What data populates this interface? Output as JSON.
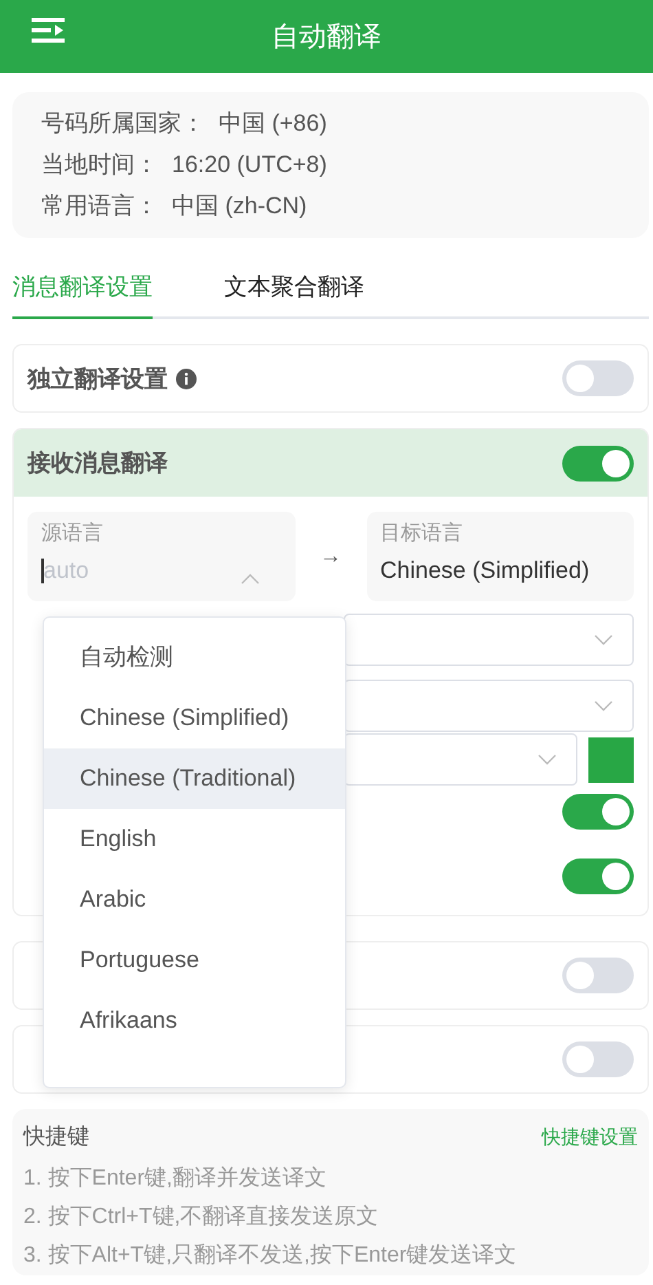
{
  "header": {
    "title": "自动翻译"
  },
  "info": [
    {
      "label": "号码所属国家：",
      "value": "中国 (+86)"
    },
    {
      "label": "当地时间：",
      "value": "16:20 (UTC+8)"
    },
    {
      "label": "常用语言：",
      "value": "中国 (zh-CN)"
    }
  ],
  "tabs": [
    {
      "label": "消息翻译设置",
      "selected": true
    },
    {
      "label": "文本聚合翻译",
      "selected": false
    }
  ],
  "independent": {
    "title": "独立翻译设置",
    "on": false
  },
  "receive": {
    "title": "接收消息翻译",
    "on": true,
    "source": {
      "label": "源语言",
      "placeholder": "auto",
      "expanded": true
    },
    "arrow": "→",
    "target": {
      "label": "目标语言",
      "value": "Chinese (Simplified)"
    },
    "rows": [
      {
        "kind": "select"
      },
      {
        "kind": "select"
      },
      {
        "kind": "select_color",
        "color": "#28a745"
      },
      {
        "kind": "toggle",
        "on": true
      },
      {
        "kind": "toggle",
        "on": true
      }
    ]
  },
  "cards": [
    {
      "on": false
    },
    {
      "on": false
    }
  ],
  "dropdown": [
    {
      "label": "自动检测",
      "selected": false
    },
    {
      "label": "Chinese (Simplified)",
      "selected": false
    },
    {
      "label": "Chinese (Traditional)",
      "selected": true
    },
    {
      "label": "English",
      "selected": false
    },
    {
      "label": "Arabic",
      "selected": false
    },
    {
      "label": "Portuguese",
      "selected": false
    },
    {
      "label": "Afrikaans",
      "selected": false
    }
  ],
  "shortcuts": {
    "title": "快捷键",
    "link": "快捷键设置",
    "lines": [
      "1. 按下Enter键,翻译并发送译文",
      "2. 按下Ctrl+T键,不翻译直接发送原文",
      "3. 按下Alt+T键,只翻译不发送,按下Enter键发送译文"
    ]
  }
}
